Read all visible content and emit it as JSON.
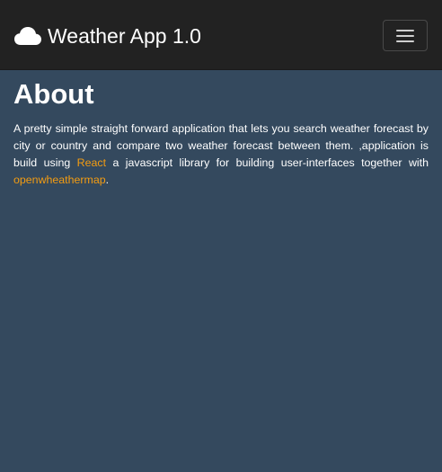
{
  "navbar": {
    "brand_icon": "cloud-icon",
    "brand_title": "Weather App 1.0",
    "toggler_icon": "hamburger-menu-icon"
  },
  "about": {
    "heading": "About",
    "text_part1": "A pretty simple straight forward application that lets you search weather forecast by city or country and compare two weather forecast between them. ,application is build using ",
    "link_react": "React",
    "text_part2": " a javascript library for building user-interfaces together with ",
    "link_openweathermap": "openwheathermap",
    "text_part3": "."
  },
  "colors": {
    "background": "#34495e",
    "navbar": "#222222",
    "link_accent": "#f39c12",
    "text": "#ffffff"
  }
}
